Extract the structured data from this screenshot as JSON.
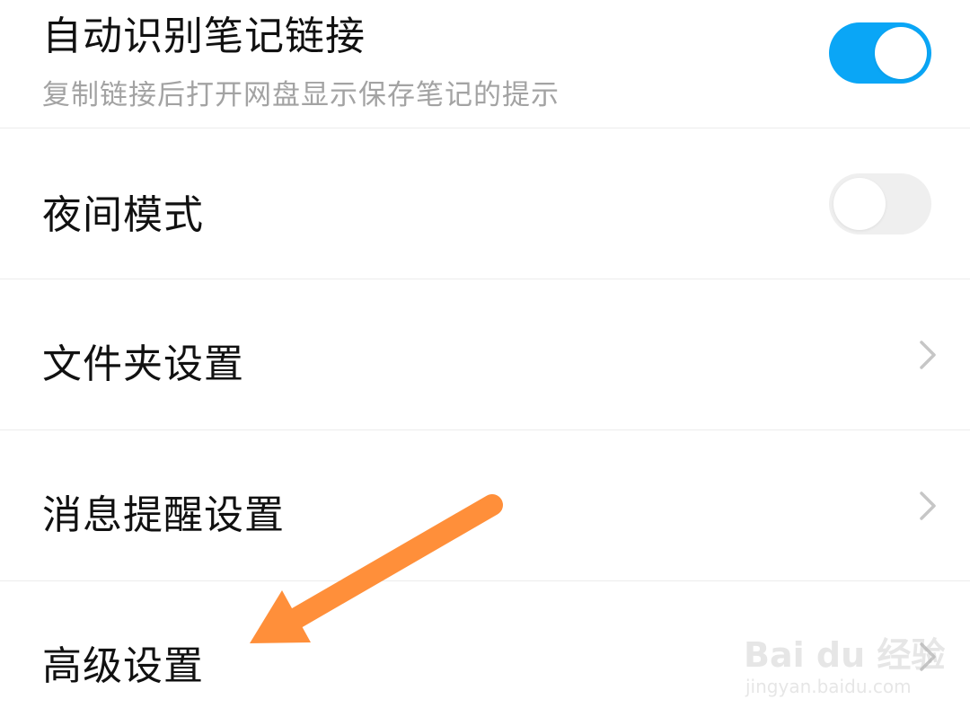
{
  "settings": {
    "items": [
      {
        "label": "自动识别笔记链接",
        "description": "复制链接后打开网盘显示保存笔记的提示",
        "control": "toggle",
        "enabled": true
      },
      {
        "label": "夜间模式",
        "control": "toggle",
        "enabled": false
      },
      {
        "label": "文件夹设置",
        "control": "chevron"
      },
      {
        "label": "消息提醒设置",
        "control": "chevron"
      },
      {
        "label": "高级设置",
        "control": "chevron"
      }
    ]
  },
  "colors": {
    "toggle_on": "#0aa6f6",
    "toggle_off": "#efefef",
    "annotation_arrow": "#ff8f3a",
    "chevron": "#c6c6c6"
  },
  "annotation": {
    "type": "arrow",
    "points_to": "高级设置"
  },
  "watermark": {
    "brand": "Bai du 经验",
    "url": "jingyan.baidu.com"
  },
  "icons": {
    "chevron": "chevron-right-icon",
    "toggle_on": "toggle-on-icon",
    "toggle_off": "toggle-off-icon"
  }
}
